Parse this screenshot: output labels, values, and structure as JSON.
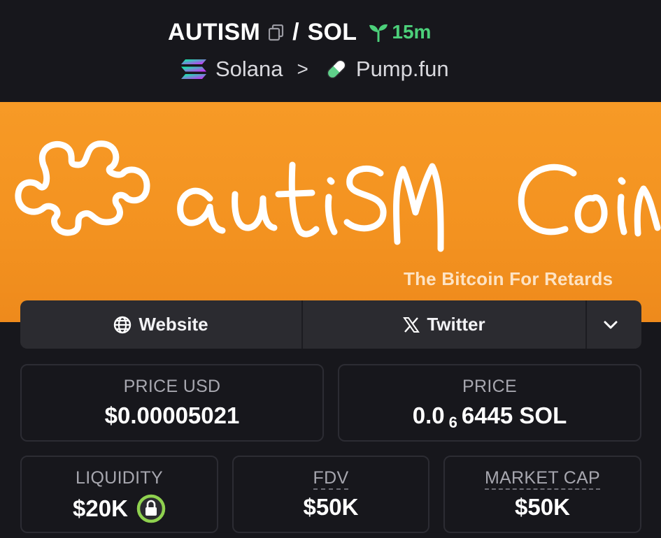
{
  "header": {
    "symbol": "AUTISM",
    "quote": "SOL",
    "slash": "/",
    "age": "15m",
    "chain": "Solana",
    "separator": ">",
    "dex": "Pump.fun"
  },
  "banner": {
    "tagline": "The Bitcoin For Retards"
  },
  "links": {
    "website": "Website",
    "twitter": "Twitter"
  },
  "stats": {
    "price_usd": {
      "label": "PRICE USD",
      "value": "$0.00005021"
    },
    "price": {
      "label": "PRICE",
      "value_prefix": "0.0",
      "value_sub": "6",
      "value_suffix": "6445 SOL"
    },
    "liquidity": {
      "label": "LIQUIDITY",
      "value": "$20K"
    },
    "fdv": {
      "label": "FDV",
      "value": "$50K"
    },
    "market_cap": {
      "label": "MARKET CAP",
      "value": "$50K"
    }
  },
  "colors": {
    "background": "#17171c",
    "banner": "#f7931e",
    "age_green": "#4cd07a",
    "lock_green": "#8fd14f"
  }
}
